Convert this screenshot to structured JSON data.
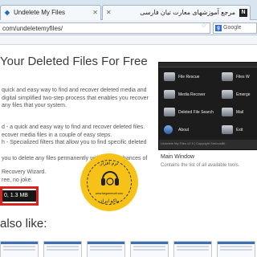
{
  "browser": {
    "tab1_title": "Undelete My Files",
    "tab2_title": "مرجع آموزشهای معارت تیان فارسی",
    "url": "com/undeletemyfiles/",
    "search_engine": "Google"
  },
  "page": {
    "headline": "Your Deleted Files For Free",
    "intro": "quick and easy way to find and recover deleted media and digital simplified two-step process that enables you recover any files that your system.",
    "features": [
      "d - a quick and easy way to find and recover deleted files.",
      "ecover media files in a couple of easy steps.",
      "h - Specialized filters that allow you to find specific deleted"
    ],
    "warning": "you to delete any files permanently without any chances of",
    "wizard": [
      "Recovery Wizard.",
      "ree, no joke."
    ],
    "download_label": "0, 1.3 MB",
    "also_like": "also like:"
  },
  "app": {
    "items": [
      "File Rescue",
      "Files W",
      "Media Recover",
      "Emerge",
      "Deleted File Search",
      "Mail",
      "About",
      "Exit"
    ],
    "status": "Undelete My Files v2.9 | Copyright SeriousBit",
    "caption_title": "Main Window",
    "caption_sub": "Contains the list of all available tools."
  },
  "stamp": {
    "top": "نرم افزار",
    "url": "www.fargamesoft.com",
    "bottom": "ماکو ایران"
  },
  "colors": {
    "download_outline": "#d9231f",
    "download_button": "#161616",
    "stamp": "#f7c217"
  }
}
